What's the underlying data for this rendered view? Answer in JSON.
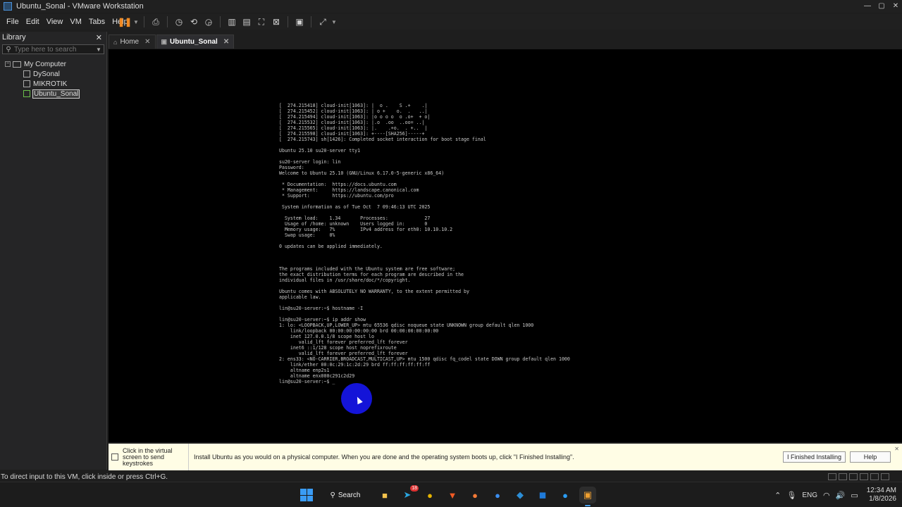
{
  "window": {
    "title": "Ubuntu_Sonal - VMware Workstation"
  },
  "menu": [
    "File",
    "Edit",
    "View",
    "VM",
    "Tabs",
    "Help"
  ],
  "library": {
    "header": "Library",
    "search_placeholder": "Type here to search",
    "root": "My Computer",
    "vms": [
      "DySonal",
      "MIKROTIK",
      "Ubuntu_Sonal"
    ],
    "selected": "Ubuntu_Sonal"
  },
  "tabs": [
    {
      "label": "Home"
    },
    {
      "label": "Ubuntu_Sonal"
    }
  ],
  "console_lines": [
    "[  274.215418] cloud-init[1063]: |  o .    S .+    .|",
    "[  274.215452] cloud-init[1063]: | o +    o.  .   ..|",
    "[  274.215494] cloud-init[1063]: |o o o o  o .o+  + o|",
    "[  274.215532] cloud-init[1063]: |.o  .oo  ..oo= ..|",
    "[  274.215565] cloud-init[1063]: |.    .+o.  . +..  |",
    "[  274.215598] cloud-init[1063]: +----[SHA256]-----+",
    "[  274.215743] sh[1426]: Completed socket interaction for boot stage final",
    "",
    "Ubuntu 25.10 su20-server tty1",
    "",
    "su20-server login: lin",
    "Password:",
    "Welcome to Ubuntu 25.10 (GNU/Linux 6.17.0-5-generic x86_64)",
    "",
    " * Documentation:  https://docs.ubuntu.com",
    " * Management:     https://landscape.canonical.com",
    " * Support:        https://ubuntu.com/pro",
    "",
    " System information as of Tue Oct  7 09:46:13 UTC 2025",
    "",
    "  System load:    1.34       Processes:             27",
    "  Usage of /home: unknown    Users logged in:       0",
    "  Memory usage:   7%         IPv4 address for eth0: 10.10.10.2",
    "  Swap usage:     0%",
    "",
    "0 updates can be applied immediately.",
    "",
    "",
    "",
    "The programs included with the Ubuntu system are free software;",
    "the exact distribution terms for each program are described in the",
    "individual files in /usr/share/doc/*/copyright.",
    "",
    "Ubuntu comes with ABSOLUTELY NO WARRANTY, to the extent permitted by",
    "applicable law.",
    "",
    "lin@su20-server:~$ hostname -I",
    "",
    "lin@su20-server:~$ ip addr show",
    "1: lo: <LOOPBACK,UP,LOWER_UP> mtu 65536 qdisc noqueue state UNKNOWN group default qlen 1000",
    "    link/loopback 00:00:00:00:00:00 brd 00:00:00:00:00:00",
    "    inet 127.0.0.1/8 scope host lo",
    "       valid_lft forever preferred_lft forever",
    "    inet6 ::1/128 scope host noprefixroute",
    "       valid_lft forever preferred_lft forever",
    "2: ens33: <NO-CARRIER,BROADCAST,MULTICAST,UP> mtu 1500 qdisc fq_codel state DOWN group default qlen 1000",
    "    link/ether 00:0c:29:1c:2d:29 brd ff:ff:ff:ff:ff:ff",
    "    altname enp2s1",
    "    altname enx000c291c2d29",
    "lin@su20-server:~$ _"
  ],
  "hint": {
    "left": "Click in the virtual screen to send keystrokes",
    "message": "Install Ubuntu as you would on a physical computer. When you are done and the operating system boots up, click \"I Finished Installing\".",
    "finished_btn": "I Finished Installing",
    "help_btn": "Help"
  },
  "status": {
    "text": "To direct input to this VM, click inside or press Ctrl+G."
  },
  "taskbar": {
    "search_label": "Search",
    "telegram_badge": "18",
    "lang": "ENG",
    "time": "12:34 AM",
    "date": "1/8/2026"
  },
  "colors": {
    "accent": "#3a9cf5",
    "pause": "#f08a24",
    "hint_bg": "#fffde5",
    "cursor_highlight": "#1414d8"
  }
}
